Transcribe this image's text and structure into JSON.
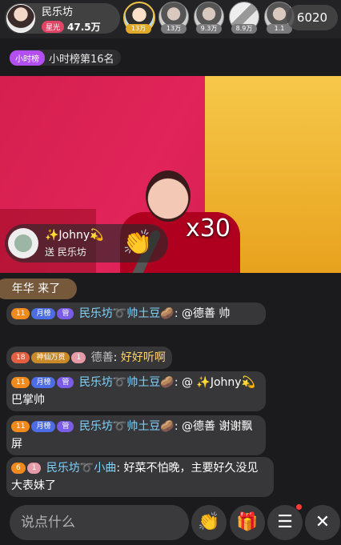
{
  "host": {
    "name": "民乐坊",
    "badge": "星光",
    "followers": "47.5万"
  },
  "viewers": [
    {
      "count": "13万"
    },
    {
      "count": "13万"
    },
    {
      "count": "9.3万"
    },
    {
      "count": "8.9万"
    },
    {
      "count": "1.1"
    }
  ],
  "online_count": "6020",
  "rank": {
    "badge": "小时榜",
    "text": "小时榜第16名"
  },
  "gift": {
    "user": "✨Johny💫",
    "to": "送 民乐坊",
    "multiplier": "x30",
    "icon": "clap-emoji"
  },
  "enter_notice": "年华 来了",
  "chat": [
    {
      "level": "11",
      "tags": [
        "月榜",
        "管"
      ],
      "user": "民乐坊➰帅土豆🥔",
      "sep": ":",
      "text": "@德善 帅"
    },
    {
      "level": "18",
      "tags": [
        "神仙万贯",
        "1"
      ],
      "user": "德善",
      "sep": ":",
      "text": "好好听啊"
    },
    {
      "level": "11",
      "tags": [
        "月榜",
        "管"
      ],
      "user": "民乐坊➰帅土豆🥔",
      "sep": ":",
      "text": "@ ✨Johny💫 巴掌帅"
    },
    {
      "level": "11",
      "tags": [
        "月榜",
        "管"
      ],
      "user": "民乐坊➰帅土豆🥔",
      "sep": ":",
      "text": "@德善 谢谢飘屏"
    },
    {
      "level": "6",
      "tags": [
        "1"
      ],
      "user": "民乐坊➰小曲",
      "sep": ":",
      "text": "好菜不怕晚，主要好久没见大表妹了"
    }
  ],
  "input_placeholder": "说点什么",
  "buttons": {
    "clap": "👏",
    "gift": "🎁",
    "menu": "☰",
    "close": "✕"
  },
  "colors": {
    "username": "#7ed3ff",
    "rank_badge": "#b34ff0",
    "star_badge": "#e04566"
  }
}
